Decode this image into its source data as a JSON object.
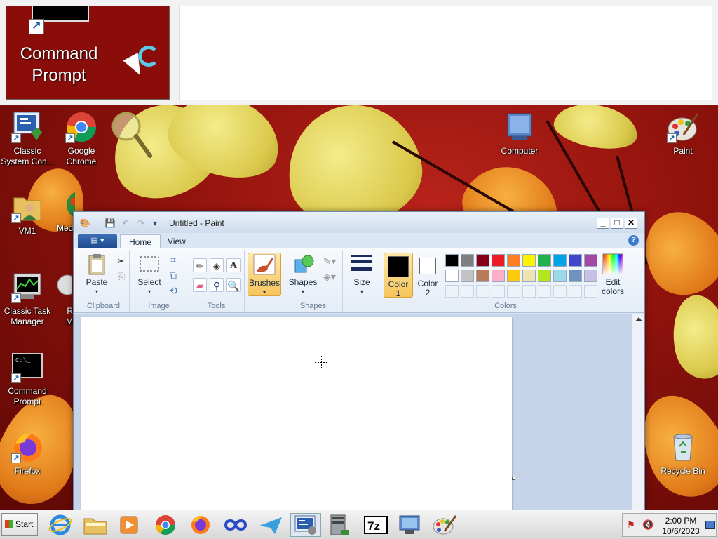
{
  "preview": {
    "label_line1": "Command",
    "label_line2": "Prompt"
  },
  "desktop_icons": [
    {
      "id": "classic-system-config",
      "line1": "Classic",
      "line2": "System Con..."
    },
    {
      "id": "google-chrome",
      "line1": "Google",
      "line2": "Chrome"
    },
    {
      "id": "computer",
      "line1": "Computer",
      "line2": ""
    },
    {
      "id": "paint",
      "line1": "Paint",
      "line2": ""
    },
    {
      "id": "vm1",
      "line1": "VM1",
      "line2": ""
    },
    {
      "id": "media",
      "line1": "Med",
      "line2": ""
    },
    {
      "id": "classic-task-manager",
      "line1": "Classic Task",
      "line2": "Manager"
    },
    {
      "id": "r-m",
      "line1": "R",
      "line2": "M"
    },
    {
      "id": "command-prompt",
      "line1": "Command",
      "line2": "Prompt"
    },
    {
      "id": "firefox",
      "line1": "Firefox",
      "line2": ""
    },
    {
      "id": "recycle-bin",
      "line1": "Recycle Bin",
      "line2": ""
    }
  ],
  "paint": {
    "title": "Untitled - Paint",
    "tabs": [
      "Home",
      "View"
    ],
    "active_tab": "Home",
    "groups": {
      "clipboard": {
        "label": "Clipboard",
        "paste": "Paste"
      },
      "image": {
        "label": "Image",
        "select": "Select"
      },
      "tools": {
        "label": "Tools"
      },
      "brushes": {
        "label": "Brushes"
      },
      "shapes": {
        "label": "Shapes",
        "shapes_btn": "Shapes"
      },
      "size": {
        "label": "Size"
      },
      "colors": {
        "label": "Colors",
        "color1_line1": "Color",
        "color1_line2": "1",
        "color2_line1": "Color",
        "color2_line2": "2",
        "edit_line1": "Edit",
        "edit_line2": "colors",
        "color1": "#000000",
        "color2": "#ffffff",
        "palette_row1": [
          "#000000",
          "#7f7f7f",
          "#880015",
          "#ed1c24",
          "#ff7f27",
          "#fff200",
          "#22b14c",
          "#00a2e8",
          "#3f48cc",
          "#a349a4"
        ],
        "palette_row2": [
          "#ffffff",
          "#c3c3c3",
          "#b97a57",
          "#ffaec9",
          "#ffc90e",
          "#efe4b0",
          "#b5e61d",
          "#99d9ea",
          "#7092be",
          "#c8bfe7"
        ]
      }
    }
  },
  "taskbar": {
    "start_label": "Start",
    "clock_time": "2:00 PM",
    "clock_date": "10/6/2023"
  }
}
